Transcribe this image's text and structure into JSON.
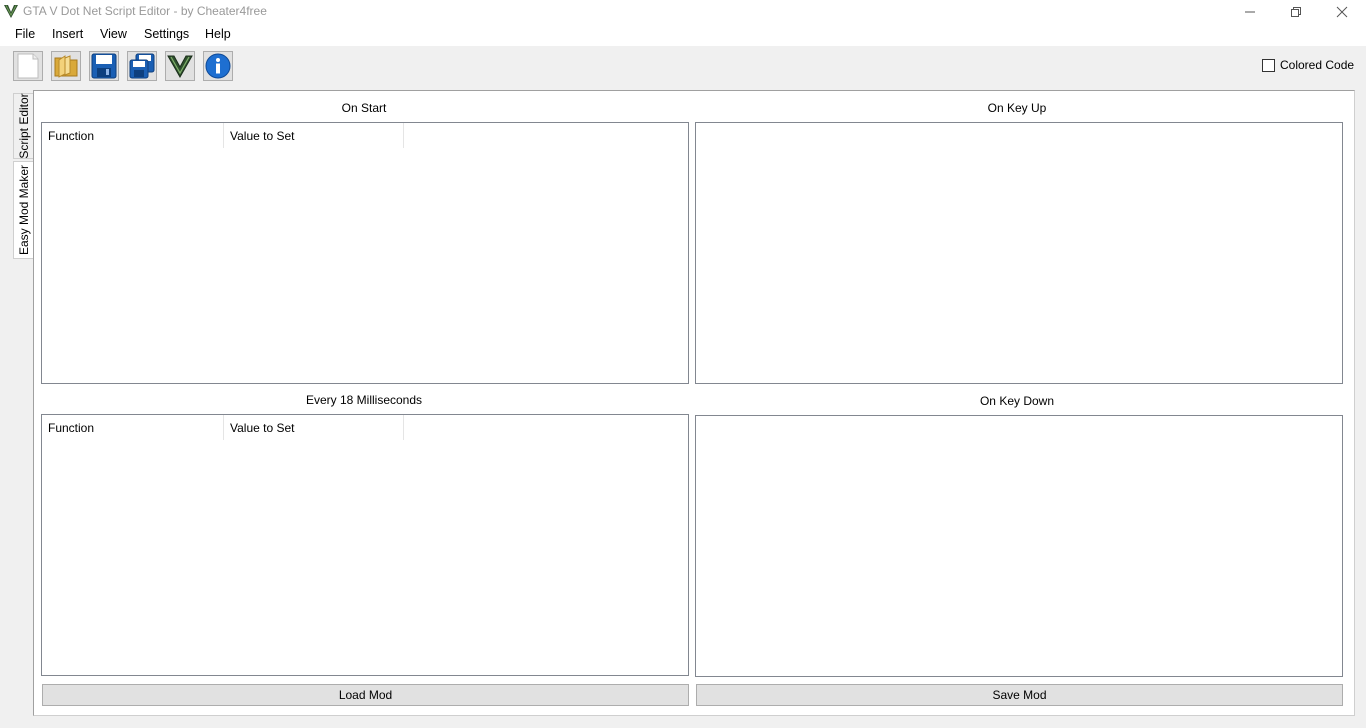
{
  "window": {
    "title": "GTA V Dot Net Script Editor - by Cheater4free"
  },
  "menu": {
    "file": "File",
    "insert": "Insert",
    "view": "View",
    "settings": "Settings",
    "help": "Help"
  },
  "toolbar": {
    "icons": [
      "new-file-icon",
      "open-folder-icon",
      "save-icon",
      "save-as-icon",
      "gta-v-icon",
      "info-icon"
    ],
    "colored_code_label": "Colored Code",
    "colored_code_checked": false
  },
  "tabs": {
    "script_editor": "Script Editor",
    "easy_mod_maker": "Easy Mod Maker",
    "active": "easy_mod_maker"
  },
  "sections": {
    "on_start": {
      "title": "On Start",
      "columns": [
        "Function",
        "Value to Set"
      ]
    },
    "on_key_up": {
      "title": "On Key Up"
    },
    "every_ms": {
      "title": "Every 18 Milliseconds",
      "columns": [
        "Function",
        "Value to Set"
      ]
    },
    "on_key_down": {
      "title": "On Key Down"
    }
  },
  "buttons": {
    "load_mod": "Load Mod",
    "save_mod": "Save Mod"
  },
  "colors": {
    "accent_green": "#4a7c3a",
    "info_blue": "#1e6fd1",
    "save_blue": "#1a5fb4"
  }
}
